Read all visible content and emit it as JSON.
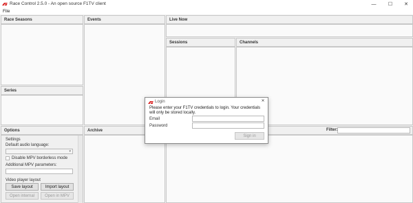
{
  "window": {
    "title": "Race Control 2.5.0 - An open source F1TV client",
    "minimize_glyph": "—",
    "maximize_glyph": "☐",
    "close_glyph": "✕"
  },
  "menu": {
    "file": "File"
  },
  "panels": {
    "race_seasons": "Race Seasons",
    "events": "Events",
    "live_now": "Live Now",
    "series": "Series",
    "sessions": "Sessions",
    "channels": "Channels",
    "options": "Options",
    "archive": "Archive",
    "filter": "Filter:"
  },
  "options": {
    "settings": "Settings",
    "default_audio": "Default audio language:",
    "disable_mpv": "Disable MPV borderless mode",
    "additional_mpv": "Additional MPV parameters:",
    "video_layout": "Video player layout",
    "save_layout": "Save layout",
    "import_layout": "Import layout",
    "open_internal": "Open internal",
    "open_in_mpv": "Open in MPV"
  },
  "login": {
    "title": "Login",
    "message": "Please enter your F1TV credentials to login. Your credentials will only be stored locally.",
    "email_label": "Email",
    "password_label": "Password",
    "sign_in": "Sign in",
    "close_glyph": "✕"
  },
  "colors": {
    "brand_red": "#d81e1e"
  },
  "icons": {
    "app": "f1-logo-icon",
    "dropdown": "chevron-down-icon"
  }
}
